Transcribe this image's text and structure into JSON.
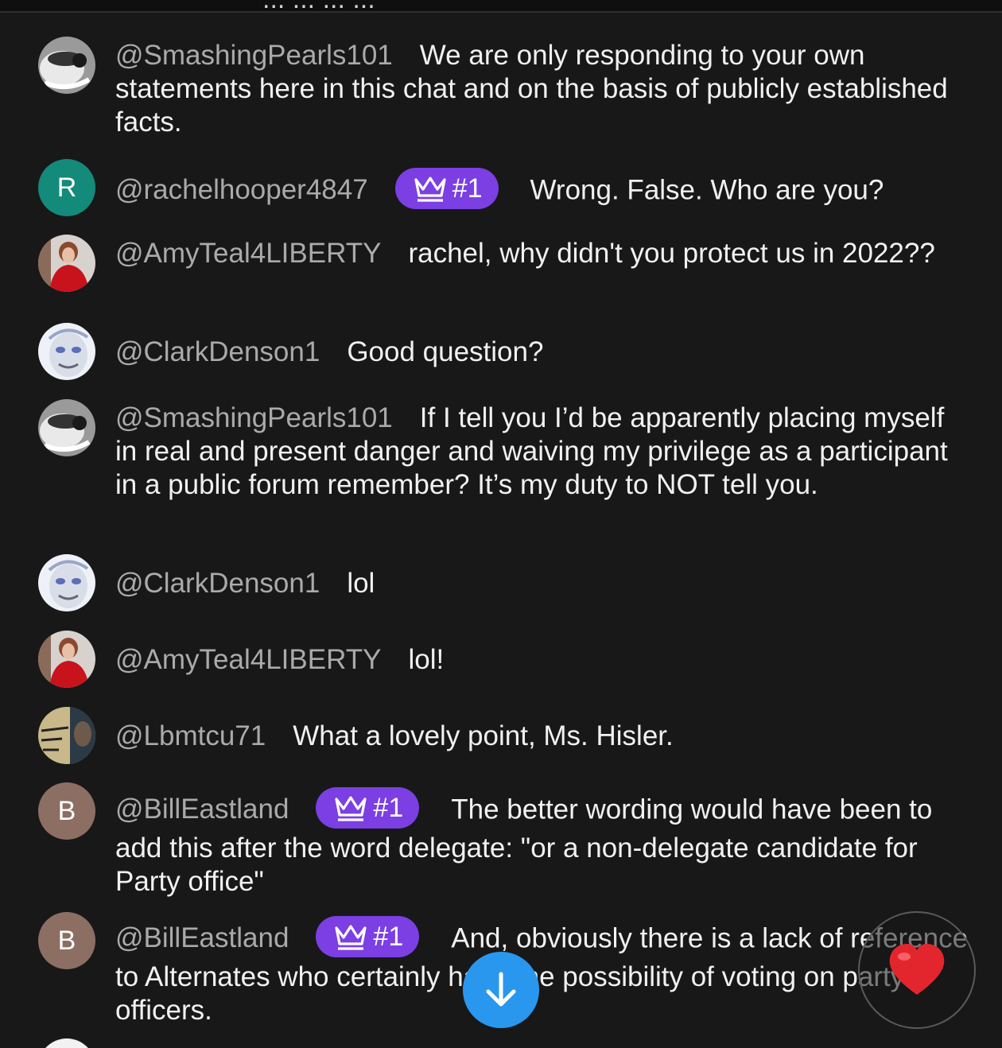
{
  "top_clipped_text": "... ... ... ...",
  "messages": [
    {
      "author": "@SmashingPearls101",
      "text": "We are only responding to your own statements here in this chat and on the basis of publicly established facts.",
      "avatar": "photo-bw"
    },
    {
      "author": "@rachelhooper4847",
      "badge": "#1",
      "text": "Wrong. False. Who are you?",
      "avatar_letter": "R",
      "avatar_color": "#138a7a"
    },
    {
      "author": "@AmyTeal4LIBERTY",
      "text": "rachel, why didn't you protect us in 2022??",
      "avatar": "photo-red"
    },
    {
      "author": "@ClarkDenson1",
      "text": "Good question?",
      "avatar": "photo-face"
    },
    {
      "author": "@SmashingPearls101",
      "text": "If I tell you I’d be apparently placing myself in real and present danger and waiving my privilege as a participant in a public forum remember? It’s my duty to NOT tell you.",
      "avatar": "photo-bw"
    },
    {
      "author": "@ClarkDenson1",
      "text": "lol",
      "avatar": "photo-face"
    },
    {
      "author": "@AmyTeal4LIBERTY",
      "text": "lol!",
      "avatar": "photo-red"
    },
    {
      "author": "@Lbmtcu71",
      "text": "What a lovely point, Ms. Hisler.",
      "avatar": "photo-poster",
      "avatar_lettering": "I'LL MAKE YOU FAMOUS"
    },
    {
      "author": "@BillEastland",
      "badge": "#1",
      "text": "The better wording would have been to add this after the word delegate: \"or a non-delegate candidate for Party office\"",
      "avatar_letter": "B",
      "avatar_color": "#8d6e63"
    },
    {
      "author": "@BillEastland",
      "badge": "#1",
      "text": "And, obviously there is a lack of reference to Alternates who certainly have the possibility of voting on party officers.",
      "avatar_letter": "B",
      "avatar_color": "#8d6e63"
    }
  ],
  "icons": {
    "badge": "crown-icon",
    "scroll_down": "arrow-down-icon",
    "reaction": "heart-icon"
  },
  "colors": {
    "background": "#181818",
    "author": "#aaaaaa",
    "badge": "#7b3fe4",
    "scroll_button": "#2a97ef",
    "heart": "#e3262d"
  }
}
